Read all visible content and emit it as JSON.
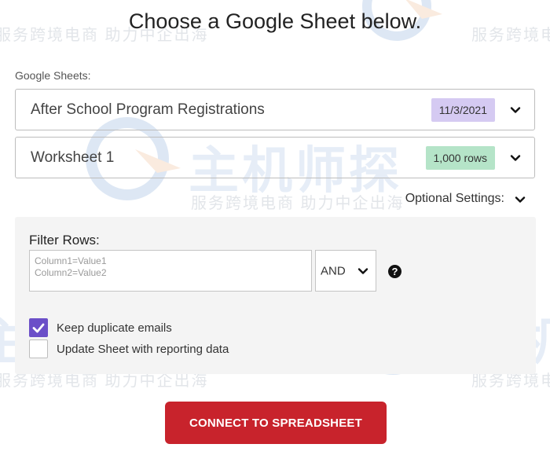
{
  "header": {
    "title": "Choose a Google Sheet below."
  },
  "sheets": {
    "label": "Google Sheets:",
    "spreadsheet": {
      "value": "After School Program Registrations",
      "badge": "11/3/2021",
      "badge_color": "#d5caf2"
    },
    "worksheet": {
      "value": "Worksheet 1",
      "badge": "1,000 rows",
      "badge_color": "#b5e4c8"
    }
  },
  "optional_settings": {
    "label": "Optional Settings:"
  },
  "filter": {
    "label": "Filter Rows:",
    "placeholder": "Column1=Value1\nColumn2=Value2",
    "operator": "AND",
    "help_glyph": "?"
  },
  "options": [
    {
      "label": "Keep duplicate emails",
      "checked": true
    },
    {
      "label": "Update Sheet with reporting data",
      "checked": false
    }
  ],
  "actions": {
    "connect_label": "CONNECT TO SPREADSHEET",
    "connect_color": "#c8232c"
  },
  "watermark": {
    "brand": "主机师探",
    "tagline": "服务跨境电商 助力中企出海",
    "tagline_left": "服务跨境电商",
    "tagline_right": "助力中企出海"
  },
  "icons": {
    "chevron": "chevron-down-icon",
    "check": "check-icon",
    "help": "question-circle-icon",
    "logo": "globe-logo-icon"
  }
}
